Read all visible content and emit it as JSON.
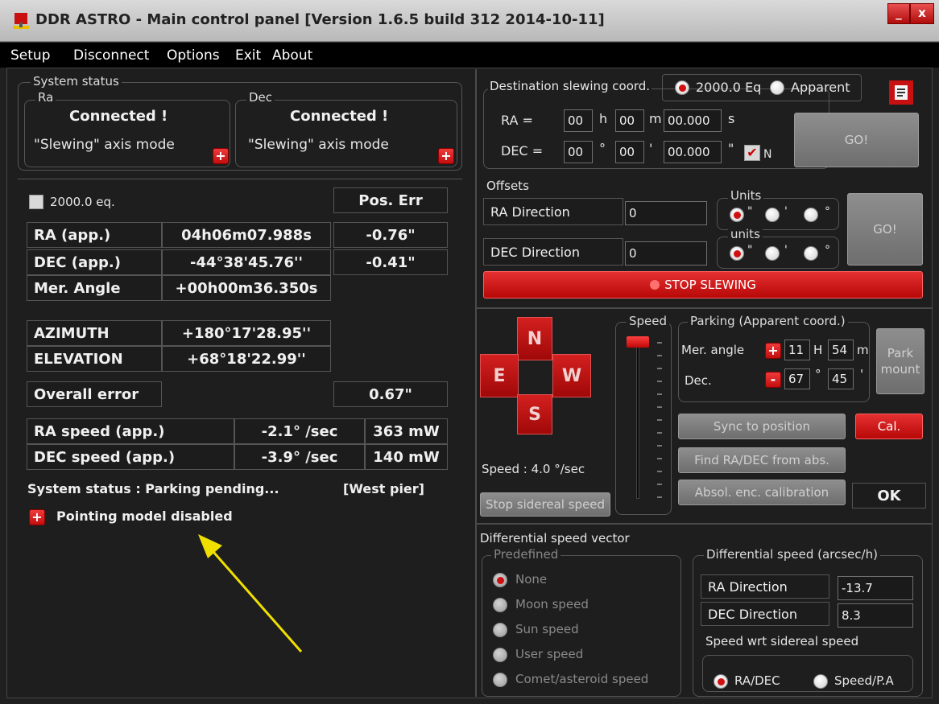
{
  "window": {
    "title": "DDR ASTRO - Main control panel  [Version  1.6.5 build 312  2014-10-11]",
    "minimize": "_",
    "close": "x"
  },
  "menu": [
    "Setup",
    "Disconnect",
    "Options",
    "Exit",
    "About"
  ],
  "system_status": {
    "legend": "System status",
    "ra": {
      "legend": "Ra",
      "status": "Connected !",
      "mode": "\"Slewing\" axis mode"
    },
    "dec": {
      "legend": "Dec",
      "status": "Connected !",
      "mode": "\"Slewing\" axis mode"
    }
  },
  "coords": {
    "eq2000_label": "2000.0 eq.",
    "pos_err_header": "Pos. Err",
    "ra_label": "RA (app.)",
    "ra_value": "04h06m07.988s",
    "ra_err": "-0.76\"",
    "dec_label": "DEC (app.)",
    "dec_value": "-44°38'45.76''",
    "dec_err": "-0.41\"",
    "mer_label": "Mer. Angle",
    "mer_value": "+00h00m36.350s",
    "az_label": "AZIMUTH",
    "az_value": "+180°17'28.95''",
    "el_label": "ELEVATION",
    "el_value": "+68°18'22.99''",
    "overall_label": "Overall error",
    "overall_value": "0.67\"",
    "ra_speed_label": "RA speed (app.)",
    "ra_speed_value": "-2.1° /sec",
    "ra_speed_mw": "363 mW",
    "dec_speed_label": "DEC speed (app.)",
    "dec_speed_value": "-3.9° /sec",
    "dec_speed_mw": "140 mW"
  },
  "status_line": {
    "text": "System status : Parking pending...",
    "pier": "[West pier]"
  },
  "pointing_model": {
    "button": "+",
    "label": "Pointing model disabled"
  },
  "destination": {
    "legend": "Destination slewing coord.",
    "eq2000": "2000.0 Eq",
    "apparent": "Apparent",
    "ra_label": "RA =",
    "ra_h": "00",
    "h": "h",
    "ra_m": "00",
    "m": "m",
    "ra_s": "00.000",
    "s": "s",
    "dec_label": "DEC =",
    "dec_d": "00",
    "deg": "°",
    "dec_m": "00",
    "min": "'",
    "dec_s": "00.000",
    "sec": "\"",
    "north": "N",
    "go": "GO!"
  },
  "offsets": {
    "legend": "Offsets",
    "ra_label": "RA Direction",
    "ra_value": "0",
    "dec_label": "DEC Direction",
    "dec_value": "0",
    "units1": "Units",
    "units2": "units",
    "u_sec": "\"",
    "u_min": "'",
    "u_deg": "°",
    "go": "GO!"
  },
  "stop_slewing": "STOP SLEWING",
  "direction": {
    "n": "N",
    "e": "E",
    "w": "W",
    "s": "S"
  },
  "speed": {
    "legend": "Speed",
    "readout": "Speed : 4.0 °/sec",
    "stop_sidereal": "Stop sidereal speed"
  },
  "parking": {
    "legend": "Parking (Apparent coord.)",
    "mer_label": "Mer. angle",
    "mer_sign": "+",
    "mer_h": "11",
    "H": "H",
    "mer_m": "54",
    "m": "m",
    "dec_label": "Dec.",
    "dec_sign": "-",
    "dec_d": "67",
    "deg": "°",
    "dec_m": "45",
    "min": "'",
    "park": "Park mount"
  },
  "actions": {
    "sync": "Sync to position",
    "cal": "Cal.",
    "find": "Find RA/DEC from abs.",
    "absol": "Absol. enc. calibration",
    "ok": "OK"
  },
  "diff": {
    "title": "Differential speed vector",
    "predefined_legend": "Predefined",
    "options": [
      "None",
      "Moon speed",
      "Sun speed",
      "User speed",
      "Comet/asteroid speed"
    ],
    "speed_legend": "Differential speed (arcsec/h)",
    "ra_label": "RA Direction",
    "ra_value": "-13.7",
    "dec_label": "DEC Direction",
    "dec_value": "8.3",
    "wrt_label": "Speed wrt sidereal speed",
    "radec": "RA/DEC",
    "speedpa": "Speed/P.A"
  },
  "colors": {
    "accent_red": "#d01010",
    "annotation_arrow": "#f0e000"
  }
}
